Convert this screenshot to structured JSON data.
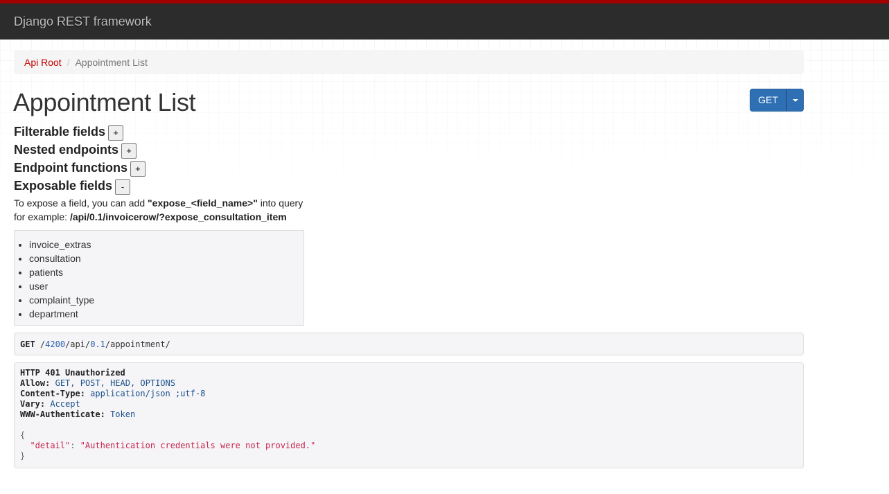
{
  "app": {
    "brand": "Django REST framework"
  },
  "breadcrumb": {
    "root": "Api Root",
    "separator": "/",
    "current": "Appointment List"
  },
  "page": {
    "title": "Appointment List"
  },
  "method_button": {
    "label": "GET"
  },
  "sections": [
    {
      "label": "Filterable fields",
      "toggle": "+"
    },
    {
      "label": "Nested endpoints",
      "toggle": "+"
    },
    {
      "label": "Endpoint functions",
      "toggle": "+"
    },
    {
      "label": "Exposable fields",
      "toggle": "-"
    }
  ],
  "expose": {
    "line1_prefix": "To expose a field, you can add ",
    "line1_bold": "\"expose_<field_name>\"",
    "line1_suffix": " into query",
    "line2_prefix": "for example: ",
    "line2_bold": "/api/0.1/invoicerow/?expose_consultation_item",
    "fields": [
      "invoice_extras",
      "consultation",
      "patients",
      "user",
      "complaint_type",
      "department"
    ]
  },
  "request": {
    "method": "GET",
    "path_parts": [
      "/",
      "4200",
      "/api/",
      "0.1",
      "/appointment/"
    ]
  },
  "response": {
    "status": "HTTP 401 Unauthorized",
    "headers": [
      {
        "name": "Allow:",
        "value": "GET, POST, HEAD, OPTIONS"
      },
      {
        "name": "Content-Type:",
        "value": "application/json ;utf-8"
      },
      {
        "name": "Vary:",
        "value": "Accept"
      },
      {
        "name": "WWW-Authenticate:",
        "value": "Token"
      }
    ],
    "open_brace": "{",
    "body_key": "\"detail\"",
    "body_colon": ": ",
    "body_value": "\"Authentication credentials were not provided.\"",
    "close_brace": "}"
  }
}
